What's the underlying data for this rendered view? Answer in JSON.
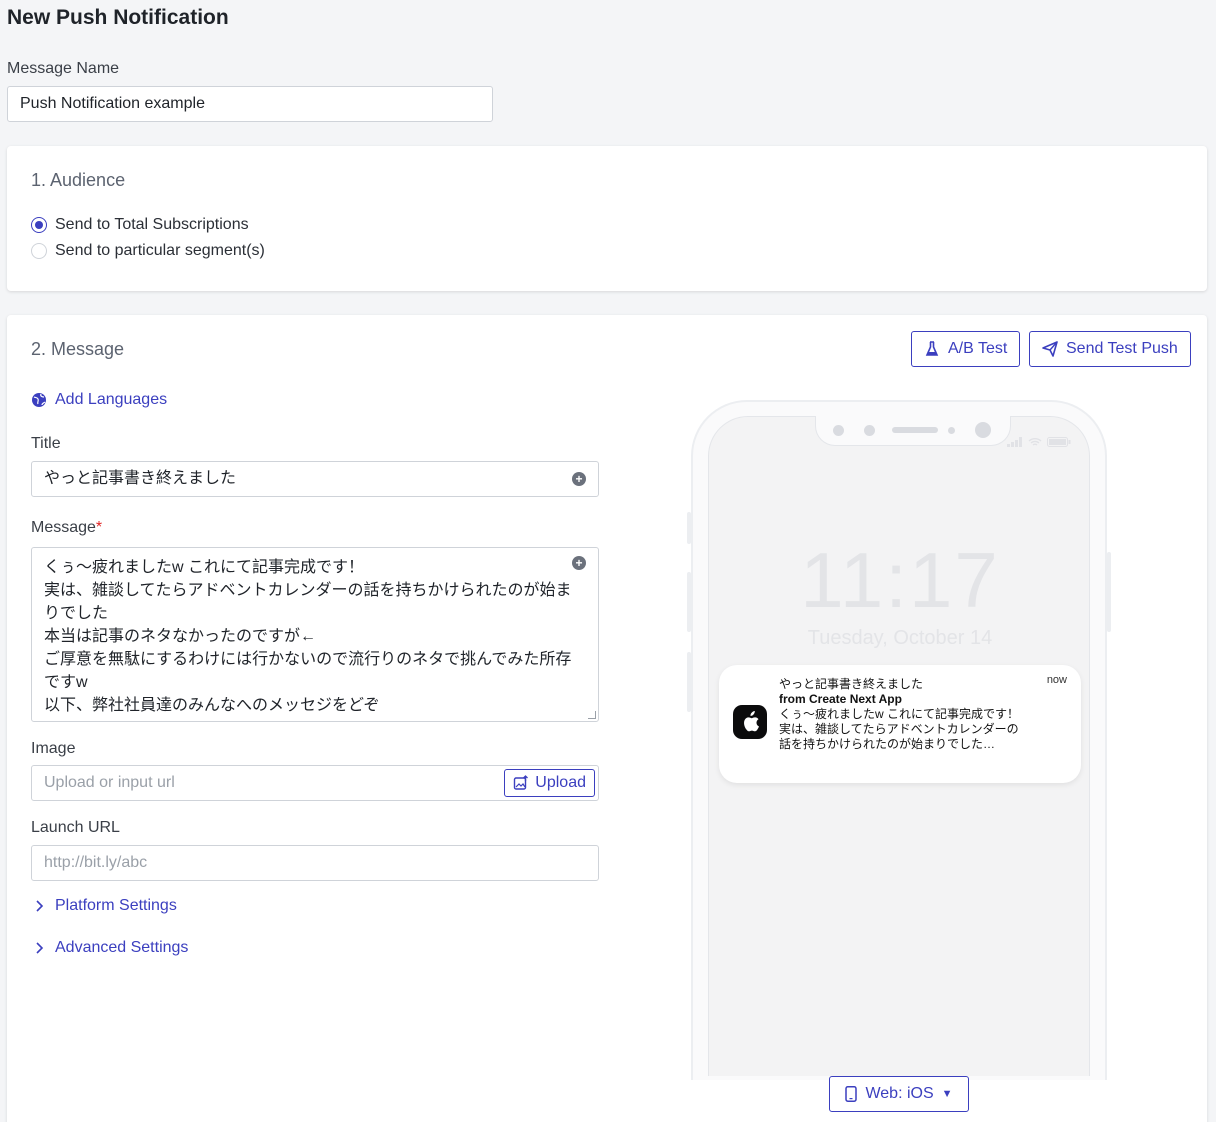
{
  "page": {
    "title": "New Push Notification"
  },
  "message_name": {
    "label": "Message Name",
    "value": "Push Notification example"
  },
  "audience": {
    "title": "1. Audience",
    "options": [
      {
        "label": "Send to Total Subscriptions",
        "selected": true
      },
      {
        "label": "Send to particular segment(s)",
        "selected": false
      }
    ]
  },
  "message_section": {
    "title": "2. Message",
    "ab_test_label": "A/B Test",
    "send_test_label": "Send Test Push",
    "add_languages_label": "Add Languages",
    "title_label": "Title",
    "title_value": "やっと記事書き終えました",
    "message_label": "Message",
    "required_mark": "*",
    "message_value": "くぅ〜疲れましたw これにて記事完成です！\n実は、雑談してたらアドベントカレンダーの話を持ちかけられたのが始まりでした\n本当は記事のネタなかったのですが←\nご厚意を無駄にするわけには行かないので流行りのネタで挑んでみた所存ですw\n以下、弊社社員達のみんなへのメッセジをどぞ",
    "image_label": "Image",
    "image_placeholder": "Upload or input url",
    "upload_label": "Upload",
    "launch_url_label": "Launch URL",
    "launch_url_placeholder": "http://bit.ly/abc",
    "platform_settings_label": "Platform Settings",
    "advanced_settings_label": "Advanced Settings"
  },
  "preview": {
    "time": "11:17",
    "date": "Tuesday, October 14",
    "notification": {
      "title": "やっと記事書き終えました",
      "from": "from Create Next App",
      "body": "くぅ〜疲れましたw これにて記事完成です！\n実は、雑談してたらアドベントカレンダーの話を持ちかけられたのが始まりでした…",
      "time": "now"
    },
    "platform_label": "Web: iOS",
    "platform_caret": "▼"
  },
  "colors": {
    "accent": "#3b3fbf",
    "background": "#f4f5f7",
    "required": "#e02424"
  }
}
